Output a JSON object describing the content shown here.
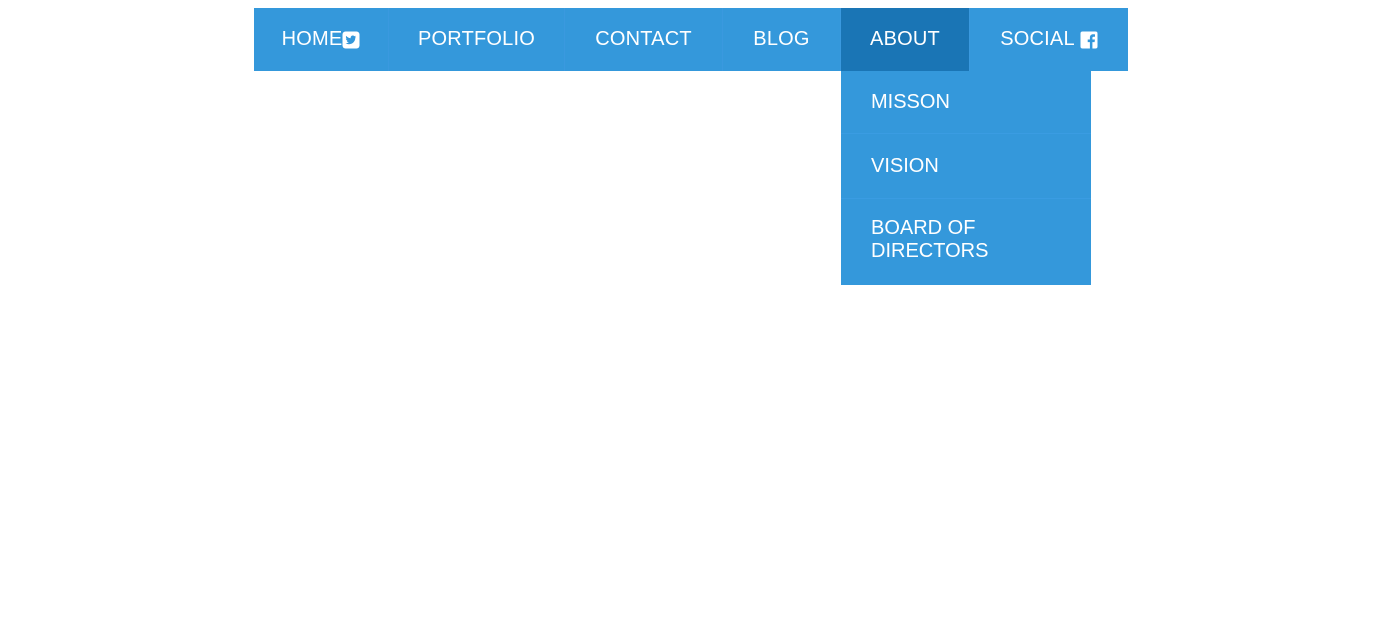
{
  "nav": {
    "items": [
      {
        "label": "HOME",
        "icon": "twitter-icon"
      },
      {
        "label": "PORTFOLIO"
      },
      {
        "label": "CONTACT"
      },
      {
        "label": "BLOG"
      },
      {
        "label": "ABOUT",
        "active": true
      },
      {
        "label": "SOCIAL",
        "icon": "facebook-icon"
      }
    ]
  },
  "dropdown": {
    "items": [
      {
        "label": "MISSON"
      },
      {
        "label": "VISION"
      },
      {
        "label": "BOARD OF DIRECTORS"
      }
    ]
  },
  "colors": {
    "nav_bg": "#3498db",
    "nav_active_bg": "#1a75b5",
    "text": "#ffffff",
    "page_bg": "#ffffff"
  }
}
